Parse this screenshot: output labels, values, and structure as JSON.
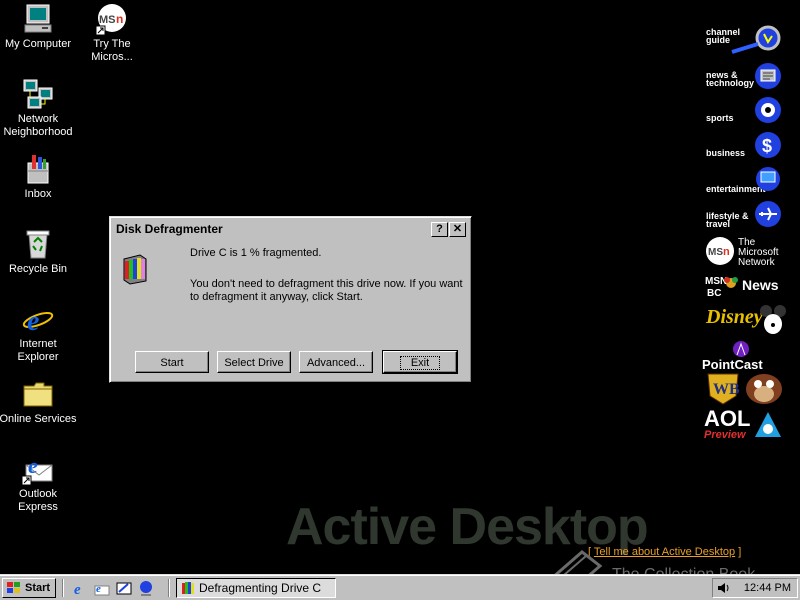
{
  "desktop": {
    "icons": [
      {
        "label": "My Computer"
      },
      {
        "label": "Try The Micros..."
      },
      {
        "label": "Network Neighborhood"
      },
      {
        "label": "Inbox"
      },
      {
        "label": "Recycle Bin"
      },
      {
        "label": "Internet Explorer"
      },
      {
        "label": "Online Services"
      },
      {
        "label": "Outlook Express"
      }
    ],
    "watermark": "Active Desktop",
    "tell_me_prefix": "[",
    "tell_me_link": "Tell me about Active Desktop",
    "tell_me_suffix": "]",
    "credit": "The Collection Book"
  },
  "channels": [
    {
      "label": "channel guide"
    },
    {
      "label": "news & technology"
    },
    {
      "label": "sports"
    },
    {
      "label": "business"
    },
    {
      "label": "entertainment"
    },
    {
      "label": "lifestyle & travel"
    },
    {
      "label": "The Microsoft Network",
      "logo": "MSN"
    },
    {
      "label": "News",
      "logo": "MSNBC"
    },
    {
      "label": "Disney",
      "logo": "Disney"
    },
    {
      "label": "PointCast",
      "logo": "PointCast"
    },
    {
      "label": "WB",
      "logo": "WB"
    },
    {
      "label": "AOL",
      "sub": "Preview"
    }
  ],
  "dialog": {
    "title": "Disk Defragmenter",
    "help_label": "?",
    "close_label": "✕",
    "line1": "Drive C is 1 % fragmented.",
    "line2": "You don't need to defragment this drive now. If you want",
    "line3": "to defragment it anyway, click Start.",
    "buttons": {
      "start": "Start",
      "select_drive": "Select Drive",
      "advanced": "Advanced...",
      "exit": "Exit"
    }
  },
  "taskbar": {
    "start_label": "Start",
    "task_label": "Defragmenting Drive C",
    "clock": "12:44 PM"
  },
  "colors": {
    "desktop": "#000000",
    "face": "#c0c0c0",
    "watermark": "#2f372f",
    "link": "#e8a028"
  }
}
